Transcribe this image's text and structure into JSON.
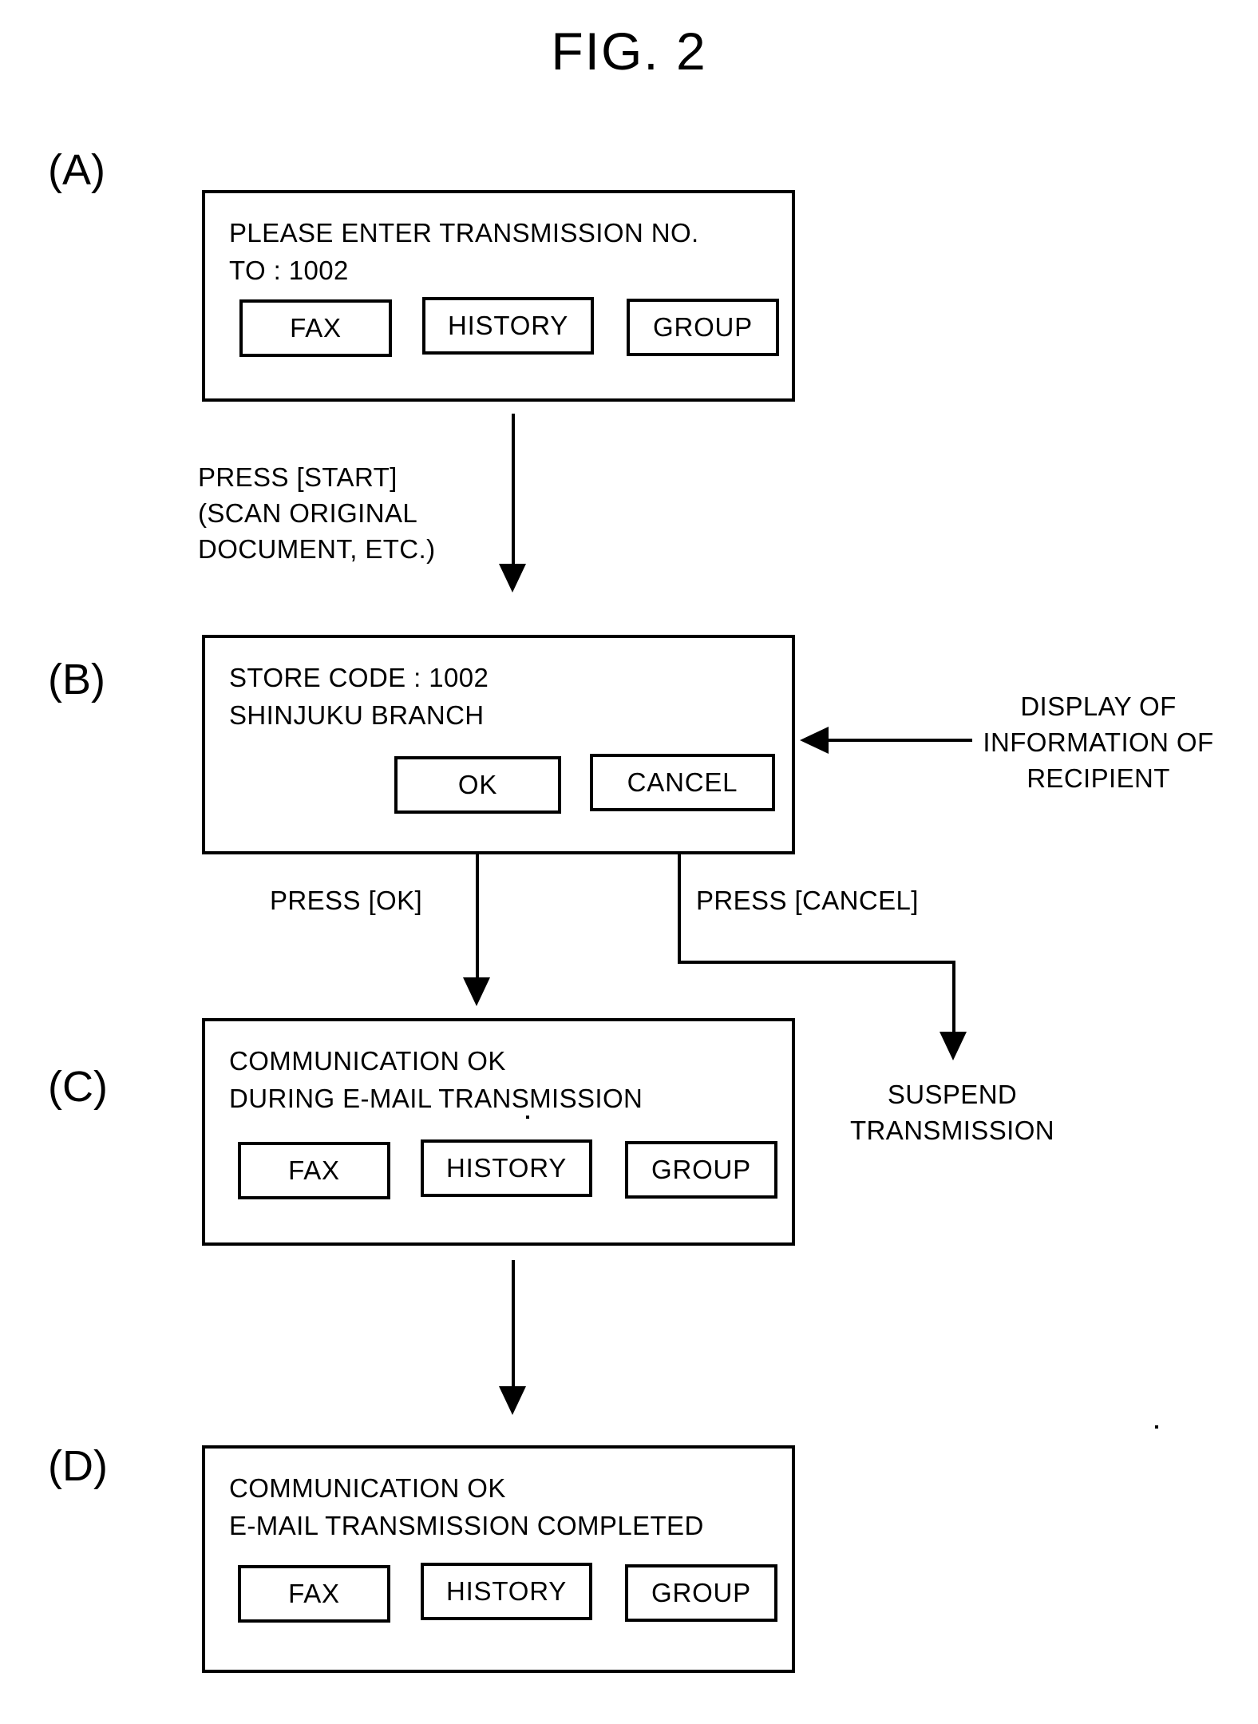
{
  "figure": {
    "title": "FIG. 2"
  },
  "panels": [
    {
      "label": "(A)",
      "lines": [
        "PLEASE ENTER TRANSMISSION NO.",
        "TO : 1002"
      ],
      "buttons": [
        "FAX",
        "HISTORY",
        "GROUP"
      ]
    },
    {
      "label": "(B)",
      "lines": [
        "STORE CODE : 1002",
        "SHINJUKU BRANCH"
      ],
      "buttons": [
        "OK",
        "CANCEL"
      ]
    },
    {
      "label": "(C)",
      "lines": [
        "COMMUNICATION OK",
        "DURING E-MAIL TRANSMISSION"
      ],
      "buttons": [
        "FAX",
        "HISTORY",
        "GROUP"
      ]
    },
    {
      "label": "(D)",
      "lines": [
        "COMMUNICATION OK",
        "E-MAIL TRANSMISSION COMPLETED"
      ],
      "buttons": [
        "FAX",
        "HISTORY",
        "GROUP"
      ]
    }
  ],
  "annotations": {
    "press_start": [
      "PRESS [START]",
      "(SCAN ORIGINAL",
      "DOCUMENT, ETC.)"
    ],
    "display_recipient": [
      "DISPLAY OF",
      "INFORMATION OF",
      "RECIPIENT"
    ],
    "press_ok": "PRESS [OK]",
    "press_cancel": "PRESS [CANCEL]",
    "suspend": [
      "SUSPEND",
      "TRANSMISSION"
    ]
  },
  "colors": {
    "ink": "#000000",
    "paper": "#ffffff"
  }
}
